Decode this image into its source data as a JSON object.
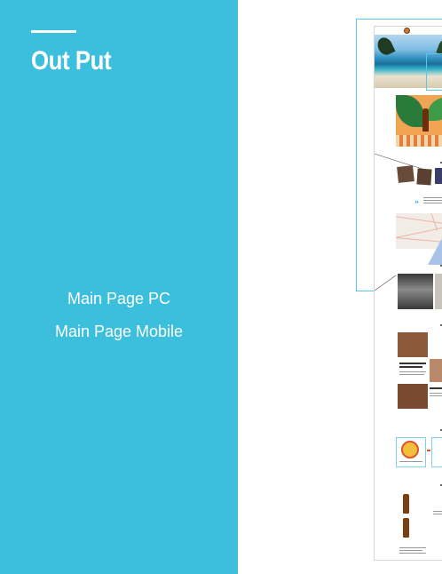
{
  "panel": {
    "title": "Out Put",
    "nav": [
      {
        "label": "Main Page PC"
      },
      {
        "label": "Main Page Mobile"
      }
    ]
  },
  "colors": {
    "accent": "#3bbfdc",
    "frame": "#57c9e4",
    "text_on_accent": "#ffffff"
  },
  "preview": {
    "description_icon": "website-mockup"
  }
}
